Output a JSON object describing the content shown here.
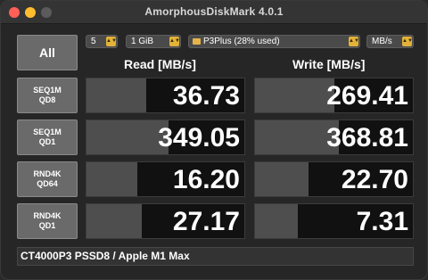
{
  "window": {
    "title": "AmorphousDiskMark 4.0.1"
  },
  "controls": {
    "all_label": "All",
    "count": "5",
    "size": "1 GiB",
    "drive": "P3Plus (28% used)",
    "unit": "MB/s"
  },
  "headers": {
    "read": "Read [MB/s]",
    "write": "Write [MB/s]"
  },
  "tests": [
    {
      "line1": "SEQ1M",
      "line2": "QD8",
      "read": "36.73",
      "write": "269.41",
      "read_fill": 0.38,
      "write_fill": 0.5
    },
    {
      "line1": "SEQ1M",
      "line2": "QD1",
      "read": "349.05",
      "write": "368.81",
      "read_fill": 0.52,
      "write_fill": 0.53
    },
    {
      "line1": "RND4K",
      "line2": "QD64",
      "read": "16.20",
      "write": "22.70",
      "read_fill": 0.32,
      "write_fill": 0.34
    },
    {
      "line1": "RND4K",
      "line2": "QD1",
      "read": "27.17",
      "write": "7.31",
      "read_fill": 0.35,
      "write_fill": 0.27
    }
  ],
  "footer": "CT4000P3 PSSD8 / Apple M1 Max",
  "colors": {
    "accent": "#e2b23a",
    "bar": "#4e4e4e",
    "cell_bg": "#111111"
  }
}
